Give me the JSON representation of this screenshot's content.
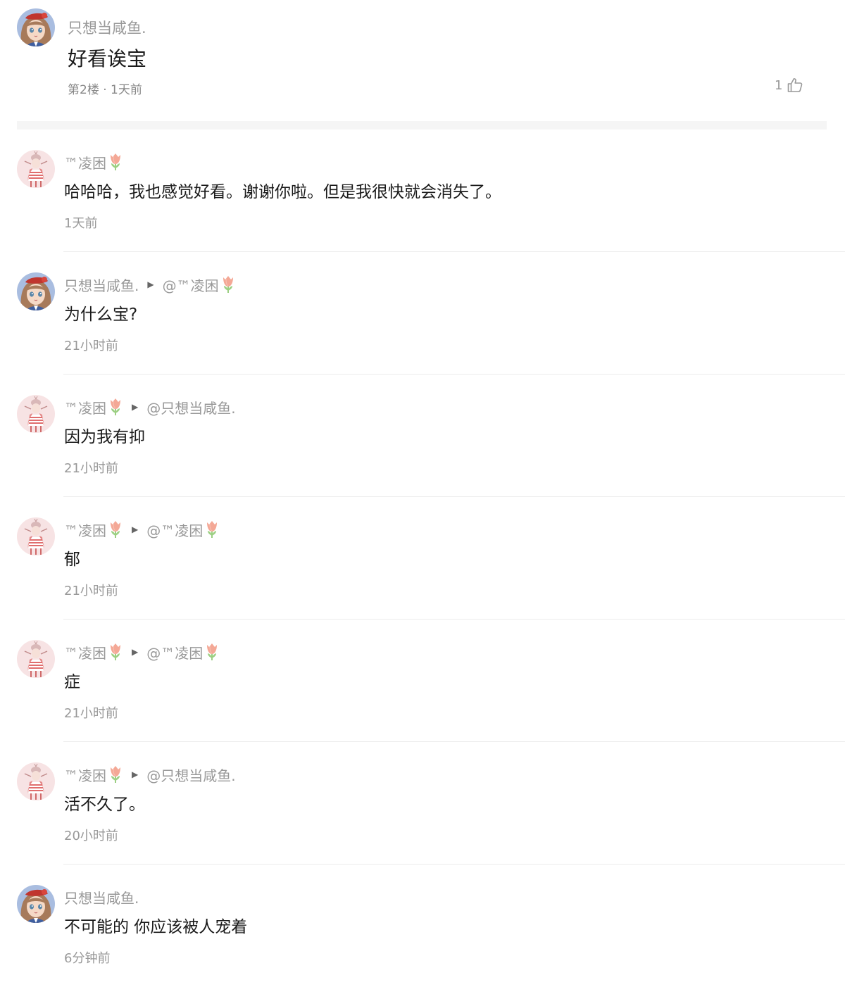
{
  "main_comment": {
    "username": "只想当咸鱼.",
    "content": "好看诶宝",
    "meta": "第2楼 · 1天前",
    "like_count": "1",
    "avatar_icon": "anime-girl-avatar-icon",
    "like_icon": "thumbs-up-icon"
  },
  "replies": [
    {
      "author": "™凌困",
      "reply_to": "",
      "text": "哈哈哈，我也感觉好看。谢谢你啦。但是我很快就会消失了。",
      "time": "1天前"
    },
    {
      "author": "只想当咸鱼.",
      "reply_to": "@™凌困",
      "text": "为什么宝?",
      "time": "21小时前"
    },
    {
      "author": "™凌困",
      "reply_to": "@只想当咸鱼.",
      "text": "因为我有抑",
      "time": "21小时前"
    },
    {
      "author": "™凌困",
      "reply_to": "@™凌困",
      "text": "郁",
      "time": "21小时前"
    },
    {
      "author": "™凌困",
      "reply_to": "@™凌困",
      "text": "症",
      "time": "21小时前"
    },
    {
      "author": "™凌困",
      "reply_to": "@只想当咸鱼.",
      "text": "活不久了。",
      "time": "20小时前"
    },
    {
      "author": "只想当咸鱼.",
      "reply_to": "",
      "text": "不可能的  你应该被人宠着",
      "time": "6分钟前"
    }
  ],
  "colors": {
    "text_primary": "#1a1a1a",
    "text_secondary": "#999999",
    "divider": "#ececec",
    "section_band": "#f5f5f5",
    "tulip_petal": "#f4a896",
    "tulip_stem": "#9ccf83"
  }
}
